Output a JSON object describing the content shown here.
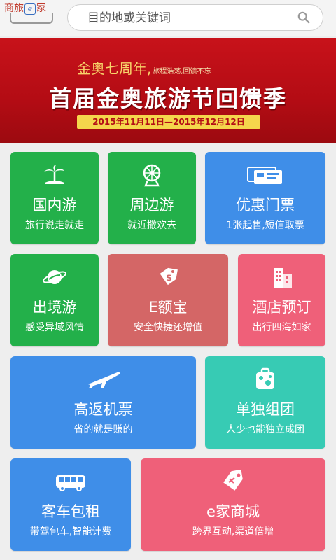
{
  "header": {
    "logo_text": [
      "商",
      "旅",
      "e",
      "家"
    ],
    "search_placeholder": "目的地或关键词",
    "search_icon": "search-icon"
  },
  "banner": {
    "headline_main": "金奥七周年,",
    "headline_sub": "旅程浩荡,回馈不忘",
    "title": "首届金奥旅游节回馈季",
    "date_range": "2015年11月11日—2015年12月12日",
    "dots_total": 3,
    "dots_active_index": 1,
    "accent_color": "#c8121a"
  },
  "tiles": [
    {
      "title": "国内游",
      "subtitle": "旅行说走就走",
      "icon": "palm-island-icon",
      "color": "#23b04a"
    },
    {
      "title": "周边游",
      "subtitle": "就近撒欢去",
      "icon": "ferris-wheel-icon",
      "color": "#23b04a"
    },
    {
      "title": "优惠门票",
      "subtitle": "1张起售,短信取票",
      "icon": "ticket-icon",
      "color": "#3f8ee8"
    },
    {
      "title": "出境游",
      "subtitle": "感受异域风情",
      "icon": "planet-icon",
      "color": "#23b04a"
    },
    {
      "title": "E额宝",
      "subtitle": "安全快捷还增值",
      "icon": "money-tag-icon",
      "color": "#d46666"
    },
    {
      "title": "酒店预订",
      "subtitle": "出行四海如家",
      "icon": "hotel-building-icon",
      "color": "#ef6079"
    },
    {
      "title": "高返机票",
      "subtitle": "省的就是赚的",
      "icon": "airplane-icon",
      "color": "#3f8ee8"
    },
    {
      "title": "单独组团",
      "subtitle": "人少也能独立成团",
      "icon": "luggage-icon",
      "color": "#37cbb4"
    },
    {
      "title": "客车包租",
      "subtitle": "带驾包车,智能计费",
      "icon": "bus-icon",
      "color": "#3f8ee8"
    },
    {
      "title": "e家商城",
      "subtitle": "跨界互动,渠道倍增",
      "icon": "shopping-tag-icon",
      "color": "#ef6079"
    }
  ]
}
